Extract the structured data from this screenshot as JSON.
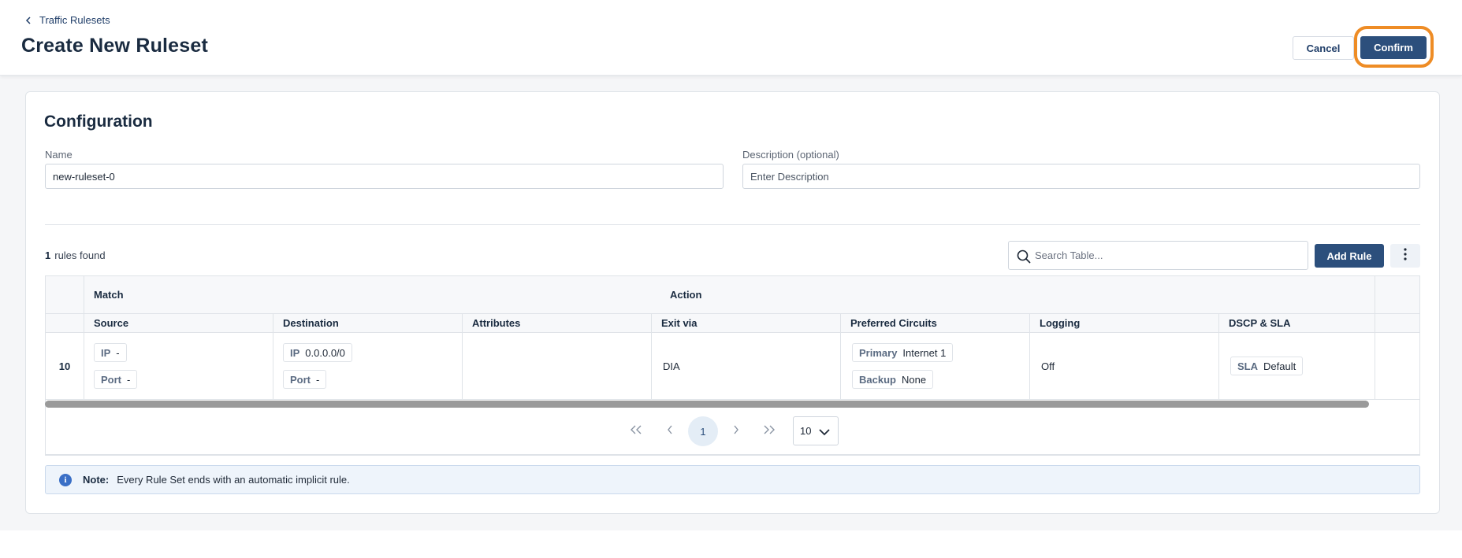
{
  "header": {
    "breadcrumb": "Traffic Rulesets",
    "title": "Create New Ruleset",
    "cancel_label": "Cancel",
    "confirm_label": "Confirm",
    "confirm_highlight_color": "#ee8c25"
  },
  "configuration": {
    "title": "Configuration",
    "name_label": "Name",
    "name_value": "new-ruleset-0",
    "description_label": "Description (optional)",
    "description_placeholder": "Enter Description"
  },
  "rules": {
    "count": "1",
    "count_text": "rules found",
    "search_placeholder": "Search Table...",
    "add_label": "Add Rule"
  },
  "table": {
    "groups": [
      "Match",
      "Action"
    ],
    "columns": [
      "Source",
      "Destination",
      "Attributes",
      "Exit via",
      "Preferred Circuits",
      "Logging",
      "DSCP & SLA"
    ],
    "rows": [
      {
        "priority": "10",
        "source": [
          {
            "k": "IP",
            "v": "-"
          },
          {
            "k": "Port",
            "v": "-"
          }
        ],
        "destination": [
          {
            "k": "IP",
            "v": "0.0.0.0/0"
          },
          {
            "k": "Port",
            "v": "-"
          }
        ],
        "attributes": "",
        "exit_via": "DIA",
        "circuits": [
          {
            "k": "Primary",
            "v": "Internet 1"
          },
          {
            "k": "Backup",
            "v": "None"
          }
        ],
        "logging": "Off",
        "dscp_sla": [
          {
            "k": "SLA",
            "v": "Default"
          }
        ]
      }
    ]
  },
  "pagination": {
    "current_page": "1",
    "page_size": "10"
  },
  "note": {
    "label": "Note:",
    "text": "Every Rule Set ends with an automatic implicit rule."
  },
  "colors": {
    "primary": "#2c4f7c",
    "highlight": "#ee8c25"
  }
}
